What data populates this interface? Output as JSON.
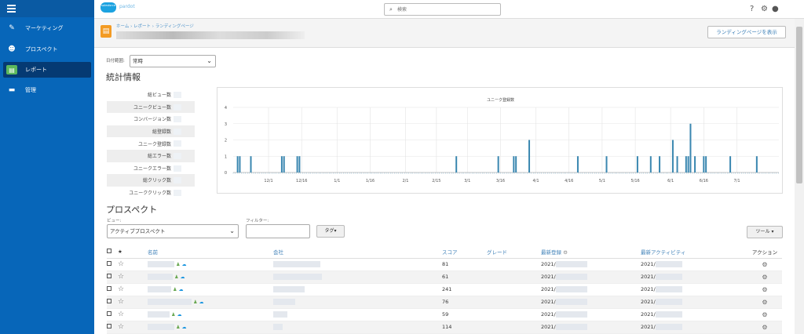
{
  "sidebar": {
    "items": [
      {
        "label": "マーケティング",
        "icon": "megaphone-icon"
      },
      {
        "label": "プロスペクト",
        "icon": "users-icon"
      },
      {
        "label": "レポート",
        "icon": "report-icon"
      },
      {
        "label": "管理",
        "icon": "briefcase-icon"
      }
    ]
  },
  "topbar": {
    "logo": "salesforce",
    "product": "pardot",
    "search_placeholder": "検索"
  },
  "header": {
    "breadcrumb": "ホーム › レポート › ランディングページ",
    "view_button": "ランディングページを表示"
  },
  "filters": {
    "date_range_label": "日付範囲:",
    "date_range_value": "常時"
  },
  "stats": {
    "title": "統計情報",
    "labels": [
      "総ビュー数",
      "ユニークビュー数",
      "コンバージョン数",
      "総登録数",
      "ユニーク登録数",
      "総エラー数",
      "ユニークエラー数",
      "総クリック数",
      "ユニーククリック数"
    ]
  },
  "chart_data": {
    "type": "bar",
    "title": "ユニーク登録数",
    "ylim": [
      0,
      4
    ],
    "yticks": [
      "0",
      "1",
      "2",
      "3",
      "4"
    ],
    "xticks": [
      "12/1",
      "12/16",
      "1/1",
      "1/16",
      "2/1",
      "2/15",
      "3/1",
      "3/16",
      "4/1",
      "4/16",
      "5/1",
      "5/16",
      "6/1",
      "6/16",
      "7/1"
    ],
    "bars": [
      {
        "x": "11/17",
        "v": 1
      },
      {
        "x": "11/18",
        "v": 1
      },
      {
        "x": "11/23",
        "v": 1
      },
      {
        "x": "12/7",
        "v": 1
      },
      {
        "x": "12/8",
        "v": 1
      },
      {
        "x": "12/14",
        "v": 1
      },
      {
        "x": "12/15",
        "v": 1
      },
      {
        "x": "2/24",
        "v": 1
      },
      {
        "x": "3/15",
        "v": 1
      },
      {
        "x": "3/22",
        "v": 1
      },
      {
        "x": "3/23",
        "v": 1
      },
      {
        "x": "3/29",
        "v": 2
      },
      {
        "x": "4/20",
        "v": 1
      },
      {
        "x": "5/3",
        "v": 1
      },
      {
        "x": "5/17",
        "v": 1
      },
      {
        "x": "5/23",
        "v": 1
      },
      {
        "x": "5/27",
        "v": 1
      },
      {
        "x": "6/2",
        "v": 2
      },
      {
        "x": "6/4",
        "v": 1
      },
      {
        "x": "6/8",
        "v": 1
      },
      {
        "x": "6/9",
        "v": 1
      },
      {
        "x": "6/10",
        "v": 3
      },
      {
        "x": "6/12",
        "v": 1
      },
      {
        "x": "6/16",
        "v": 1
      },
      {
        "x": "6/17",
        "v": 1
      },
      {
        "x": "6/28",
        "v": 1
      },
      {
        "x": "7/10",
        "v": 1
      }
    ]
  },
  "prospects": {
    "title": "プロスペクト",
    "view_label": "ビュー:",
    "view_value": "アクティブプロスペクト",
    "filter_label": "フィルター:",
    "tag_button": "タグ▾",
    "tools_button": "ツール ▾",
    "columns": [
      "名前",
      "会社",
      "スコア",
      "グレード",
      "最新登録",
      "最新アクティビティ",
      "アクション"
    ],
    "rows": [
      {
        "score": "81",
        "reg": "2021/",
        "act": "2021/"
      },
      {
        "score": "61",
        "reg": "2021/",
        "act": "2021/"
      },
      {
        "score": "241",
        "reg": "2021/",
        "act": "2021/"
      },
      {
        "score": "76",
        "reg": "2021/",
        "act": "2021/"
      },
      {
        "score": "59",
        "reg": "2021/",
        "act": "2021/"
      },
      {
        "score": "114",
        "reg": "2021/",
        "act": "2021/"
      }
    ]
  }
}
